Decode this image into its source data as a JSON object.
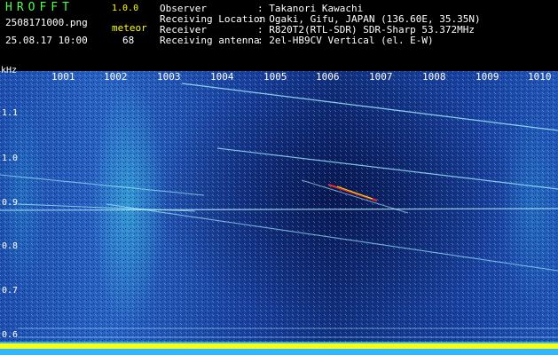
{
  "header": {
    "app_title": "HROFFT",
    "app_version": "1.0.0",
    "filename": "2508171000.png",
    "datetime": "25.08.17 10:00",
    "meteor_label": "meteor",
    "meteor_count": "68",
    "info": [
      {
        "label": "Observer",
        "value": ": Takanori Kawachi"
      },
      {
        "label": "Receiving Location",
        "value": ": Ogaki, Gifu, JAPAN (136.60E, 35.35N)"
      },
      {
        "label": "Receiver",
        "value": ": R820T2(RTL-SDR) SDR-Sharp 53.372MHz"
      },
      {
        "label": "Receiving antenna",
        "value": ": 2el-HB9CV Vertical (el. E-W)"
      }
    ]
  },
  "spectrogram": {
    "y_unit": "kHz",
    "y_ticks": [
      "1.1",
      "1.0",
      "0.9",
      "0.8",
      "0.7",
      "0.6"
    ],
    "x_ticks": [
      "1001",
      "1002",
      "1003",
      "1004",
      "1005",
      "1006",
      "1007",
      "1008",
      "1009",
      "1010"
    ],
    "colors": {
      "background": "#000000",
      "label_green": "#4dff4d",
      "label_yellow": "#ffff00",
      "trace": "#9fe8ff",
      "meteor_hot": "#ff3030",
      "baseline_band": "#ffff00"
    }
  }
}
